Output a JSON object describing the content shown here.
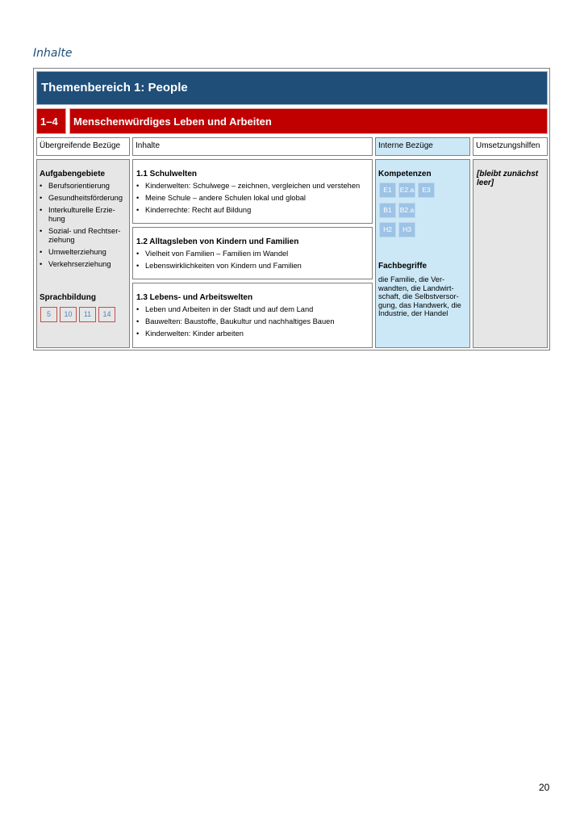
{
  "section_title": "Inhalte",
  "theme": "Themenbereich 1: People",
  "unit": {
    "number": "1–4",
    "title": "Menschenwürdiges Leben und Arbeiten"
  },
  "columns": [
    "Übergreifende Bezüge",
    "Inhalte",
    "Interne Bezüge",
    "Umsetzungshilfen"
  ],
  "left": {
    "aufgaben_title": "Aufgabengebiete",
    "aufgaben": [
      "Berufsorientierung",
      "Gesundheitsförderung",
      "Interkulturelle Erzie-\nhung",
      "Sozial- und Rechtser-\nziehung",
      "Umwelterziehung",
      "Verkehrserziehung"
    ],
    "sprach_title": "Sprachbildung",
    "sprach": [
      "5",
      "10",
      "11",
      "14"
    ]
  },
  "content": [
    {
      "title": "1.1 Schulwelten",
      "items": [
        "Kinderwelten: Schulwege – zeichnen, vergleichen und verstehen",
        "Meine Schule – andere Schulen lokal und global",
        "Kinderrechte: Recht auf Bildung"
      ]
    },
    {
      "title": "1.2 Alltagsleben von Kindern und Familien",
      "items": [
        "Vielheit von Familien – Familien im Wandel",
        "Lebenswirklichkeiten von Kindern und Familien"
      ]
    },
    {
      "title": "1.3 Lebens- und Arbeitswelten",
      "items": [
        "Leben und Arbeiten in der Stadt und auf dem Land",
        "Bauwelten: Baustoffe, Baukultur und nachhaltiges Bauen",
        "Kinderwelten: Kinder arbeiten"
      ]
    }
  ],
  "internal": {
    "kompetenzen_title": "Kompetenzen",
    "kompetenzen": [
      [
        "E1",
        "E2.a",
        "E3"
      ],
      [
        "B1",
        "B2.a"
      ],
      [
        "H2",
        "H3"
      ]
    ],
    "fach_title": "Fachbegriffe",
    "fach_text": "die Familie, die Ver-\nwandten, die Landwirt-\nschaft, die Selbstversor-\ngung, das Handwerk, die\nIndustrie, der Handel"
  },
  "umsetzung": "[bleibt zunächst\nleer]",
  "page_number": "20"
}
